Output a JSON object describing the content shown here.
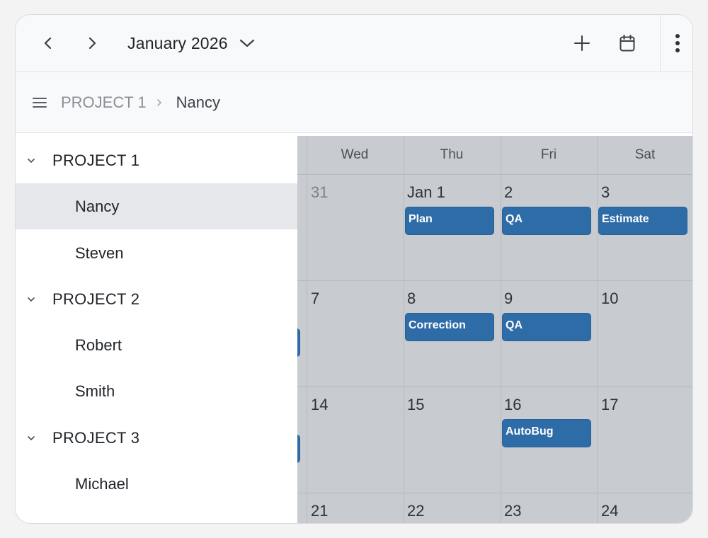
{
  "toolbar": {
    "month_label": "January 2026",
    "prev_icon": "chevron-left-icon",
    "next_icon": "chevron-right-icon",
    "dropdown_icon": "chevron-down-icon",
    "add_icon": "plus-icon",
    "calendar_icon": "calendar-icon",
    "more_icon": "more-vertical-icon"
  },
  "breadcrumb": {
    "menu_icon": "hamburger-icon",
    "project": "PROJECT 1",
    "separator_icon": "chevron-right-icon",
    "current": "Nancy"
  },
  "calendar": {
    "weekdays": [
      "Wed",
      "Thu",
      "Fri",
      "Sat"
    ],
    "weeks": [
      {
        "days": [
          "31",
          "Jan 1",
          "2",
          "3"
        ]
      },
      {
        "days": [
          "7",
          "8",
          "9",
          "10"
        ]
      },
      {
        "days": [
          "14",
          "15",
          "16",
          "17"
        ]
      },
      {
        "days": [
          "21",
          "22",
          "23",
          "24"
        ]
      }
    ],
    "events": [
      {
        "title": "Plan",
        "week": 0,
        "day": 1
      },
      {
        "title": "QA",
        "week": 0,
        "day": 2
      },
      {
        "title": "Estimate",
        "week": 0,
        "day": 3
      },
      {
        "title": "Correction",
        "week": 1,
        "day": 1
      },
      {
        "title": "QA",
        "week": 1,
        "day": 2
      },
      {
        "title": "AutoBug",
        "week": 2,
        "day": 2
      }
    ],
    "event_color": "#2e6ca8"
  },
  "tree": {
    "groups": [
      {
        "label": "PROJECT 1",
        "items": [
          "Nancy",
          "Steven"
        ]
      },
      {
        "label": "PROJECT 2",
        "items": [
          "Robert",
          "Smith"
        ]
      },
      {
        "label": "PROJECT 3",
        "items": [
          "Michael"
        ]
      }
    ],
    "selected": "Nancy"
  }
}
